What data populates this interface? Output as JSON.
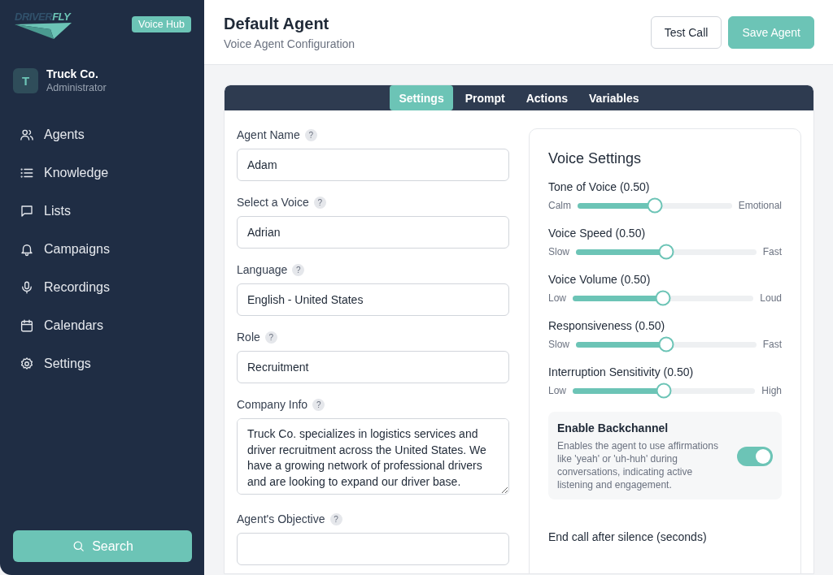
{
  "sidebar": {
    "logo": {
      "part_1": "DRIVER",
      "part_2": "FLY"
    },
    "badge": "Voice Hub",
    "account": {
      "initial": "T",
      "name": "Truck Co.",
      "role": "Administrator"
    },
    "items": [
      {
        "label": "Agents",
        "selected": false
      },
      {
        "label": "Knowledge",
        "selected": false
      },
      {
        "label": "Lists",
        "selected": false
      },
      {
        "label": "Campaigns",
        "selected": false
      },
      {
        "label": "Recordings",
        "selected": false
      },
      {
        "label": "Calendars",
        "selected": false
      },
      {
        "label": "Settings",
        "selected": false
      }
    ],
    "search_button": "Search"
  },
  "header": {
    "title": "Default Agent",
    "subtitle": "Voice Agent Configuration",
    "buttons": [
      {
        "label": "Test Call",
        "kind": "secondary"
      },
      {
        "label": "Save Agent",
        "kind": "primary"
      }
    ]
  },
  "tabs": [
    {
      "label": "Settings",
      "selected": true
    },
    {
      "label": "Prompt",
      "selected": false
    },
    {
      "label": "Actions",
      "selected": false
    },
    {
      "label": "Variables",
      "selected": false
    }
  ],
  "fields": [
    {
      "label": "Agent Name",
      "help": "?",
      "kind": "input",
      "value": "Adam"
    },
    {
      "label": "Select a Voice",
      "help": "?",
      "kind": "input",
      "value": "Adrian"
    },
    {
      "label": "Language",
      "help": "?",
      "kind": "input",
      "value": "English - United States"
    },
    {
      "label": "Role",
      "help": "?",
      "kind": "input",
      "value": "Recruitment"
    },
    {
      "label": "Company Info",
      "help": "?",
      "kind": "textarea",
      "value": "Truck Co. specializes in logistics services and driver recruitment across the United States. We have a growing network of professional drivers and are looking to expand our driver base."
    },
    {
      "label": "Agent's Objective",
      "help": "?",
      "kind": "input"
    }
  ],
  "voice_settings": {
    "title": "Voice Settings",
    "sliders": [
      {
        "label": "Tone of Voice (0.50)",
        "min_label": "Calm",
        "max_label": "Emotional",
        "level": 0.5
      },
      {
        "label": "Voice Speed (0.50)",
        "min_label": "Slow",
        "max_label": "Fast",
        "level": 0.5
      },
      {
        "label": "Voice Volume (0.50)",
        "min_label": "Low",
        "max_label": "Loud",
        "level": 0.5
      },
      {
        "label": "Responsiveness (0.50)",
        "min_label": "Slow",
        "max_label": "Fast",
        "level": 0.5
      },
      {
        "label": "Interruption Sensitivity (0.50)",
        "min_label": "Low",
        "max_label": "High",
        "level": 0.5
      }
    ],
    "toggle": {
      "title": "Enable Backchannel",
      "description": "Enables the agent to use affirmations like 'yeah' or 'uh-huh' during conversations, indicating active listening and engagement.",
      "on": true
    },
    "next_label": "End call after silence (seconds)"
  }
}
